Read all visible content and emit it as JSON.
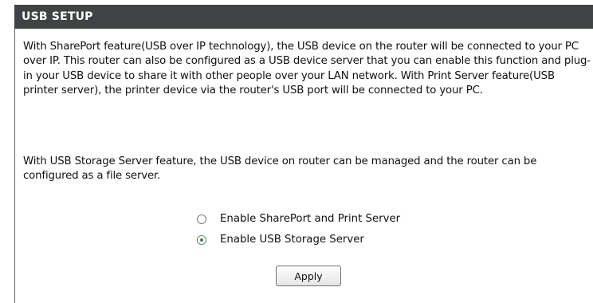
{
  "section": {
    "title": "USB SETUP"
  },
  "description": {
    "paragraph1": "With SharePort feature(USB over IP technology), the USB device on the router will be connected to your PC over IP. This router can also be configured as a USB device server that you can enable this function and plug-in your USB device to share it with other people over your LAN network. With Print Server feature(USB printer server), the printer device via the router's USB port will be connected to your PC.",
    "paragraph2": "With USB Storage Server feature, the USB device on router can be managed and the router can be configured as a file server."
  },
  "options": [
    {
      "label": "Enable SharePort and Print Server",
      "selected": false
    },
    {
      "label": "Enable USB Storage Server",
      "selected": true
    }
  ],
  "buttons": {
    "apply_label": "Apply"
  },
  "colors": {
    "header_bg": "#404343",
    "header_text": "#ffffff",
    "radio_selected": "#2a8a3a"
  }
}
